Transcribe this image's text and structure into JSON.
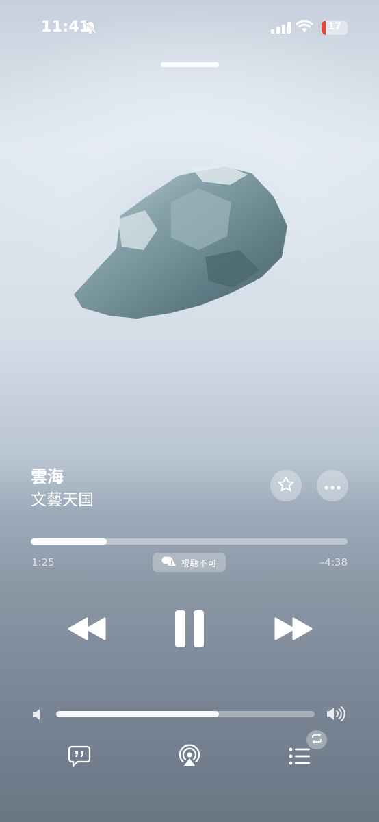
{
  "status_bar": {
    "time": "11:41",
    "battery_level": "17",
    "icons": [
      "bell-slash-icon",
      "signal-icon",
      "wifi-icon",
      "battery-icon"
    ]
  },
  "track": {
    "title": "雲海",
    "artist": "文藝天国"
  },
  "playback": {
    "elapsed": "1:25",
    "remaining": "–4:38",
    "progress_fraction": 0.24,
    "badge_label": "視聴不可",
    "state": "playing"
  },
  "volume": {
    "level_fraction": 0.63
  },
  "icons": {
    "favorite": "star-icon",
    "more": "ellipsis-icon",
    "rewind": "rewind-icon",
    "pause": "pause-icon",
    "forward": "fast-forward-icon",
    "lyrics": "lyrics-icon",
    "airplay": "airplay-icon",
    "queue": "list-icon",
    "repeat": "repeat-icon"
  },
  "colors": {
    "accent": "#ffffff",
    "battery_low": "#e5483c"
  }
}
